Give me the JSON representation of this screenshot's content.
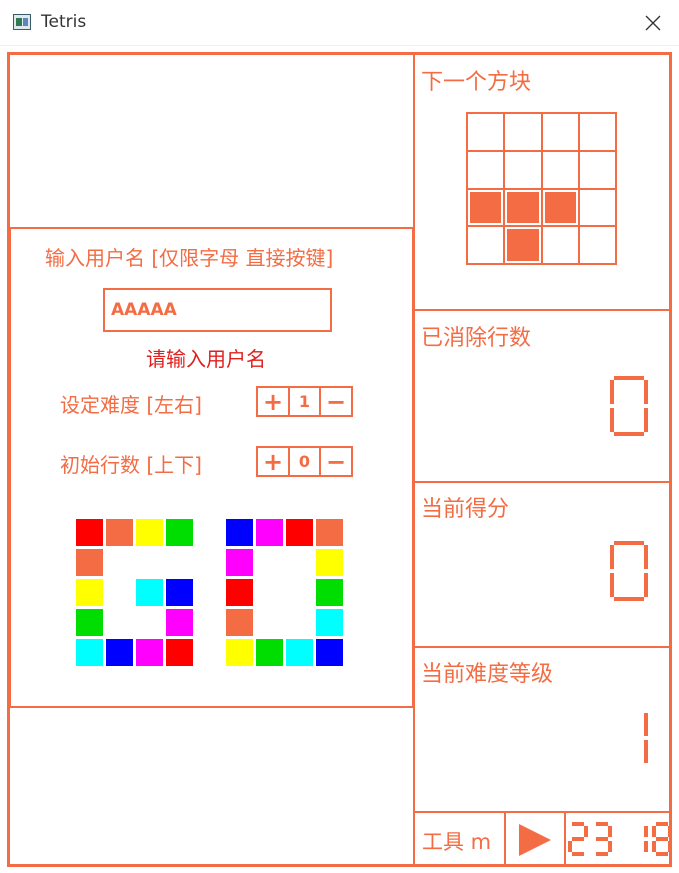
{
  "window": {
    "title": "Tetris",
    "close_label": "✕"
  },
  "sidebar": {
    "next_piece_label": "下一个方块",
    "lines_cleared_label": "已消除行数",
    "lines_cleared_value": "0",
    "score_label": "当前得分",
    "score_value": "0",
    "level_label": "当前难度等级",
    "level_value": "1"
  },
  "next_piece": {
    "rows": 4,
    "cols": 4,
    "filled": [
      [
        2,
        0
      ],
      [
        2,
        1
      ],
      [
        2,
        2
      ],
      [
        3,
        1
      ]
    ],
    "color": "#f36c43"
  },
  "dialog": {
    "title": "输入用户名 [仅限字母 直接按键]",
    "username_value": "AAAAA",
    "hint": "请输入用户名",
    "difficulty_label": "设定难度 [左右]",
    "difficulty_value": "1",
    "initial_rows_label": "初始行数 [上下]",
    "initial_rows_value": "0",
    "plus_label": "+",
    "minus_label": "−"
  },
  "footer": {
    "tools_label": "工具 m",
    "clock": "23 18"
  },
  "colors": {
    "accent": "#f36c43",
    "hint_red": "#e0201e"
  },
  "go_logo": {
    "g_blocks": [
      {
        "c": "#ff0000"
      },
      {
        "c": "#f36c43"
      },
      {
        "c": "#ffff00"
      },
      {
        "c": "#00dd00"
      },
      {
        "c": "#f36c43"
      },
      {
        "c": "#ffff00"
      },
      {
        "c": "#00ffff"
      },
      {
        "c": "#0000ff"
      },
      {
        "c": "#00dd00"
      },
      {
        "c": "#ff00ff"
      },
      {
        "c": "#00ffff"
      },
      {
        "c": "#0000ff"
      },
      {
        "c": "#ff00ff"
      },
      {
        "c": "#ff0000"
      }
    ],
    "o_blocks": [
      {
        "c": "#0000ff"
      },
      {
        "c": "#ff00ff"
      },
      {
        "c": "#ff0000"
      },
      {
        "c": "#f36c43"
      },
      {
        "c": "#ff00ff"
      },
      {
        "c": "#ffff00"
      },
      {
        "c": "#ff0000"
      },
      {
        "c": "#00dd00"
      },
      {
        "c": "#f36c43"
      },
      {
        "c": "#00ffff"
      },
      {
        "c": "#ffff00"
      },
      {
        "c": "#00dd00"
      },
      {
        "c": "#00ffff"
      },
      {
        "c": "#0000ff"
      }
    ]
  }
}
